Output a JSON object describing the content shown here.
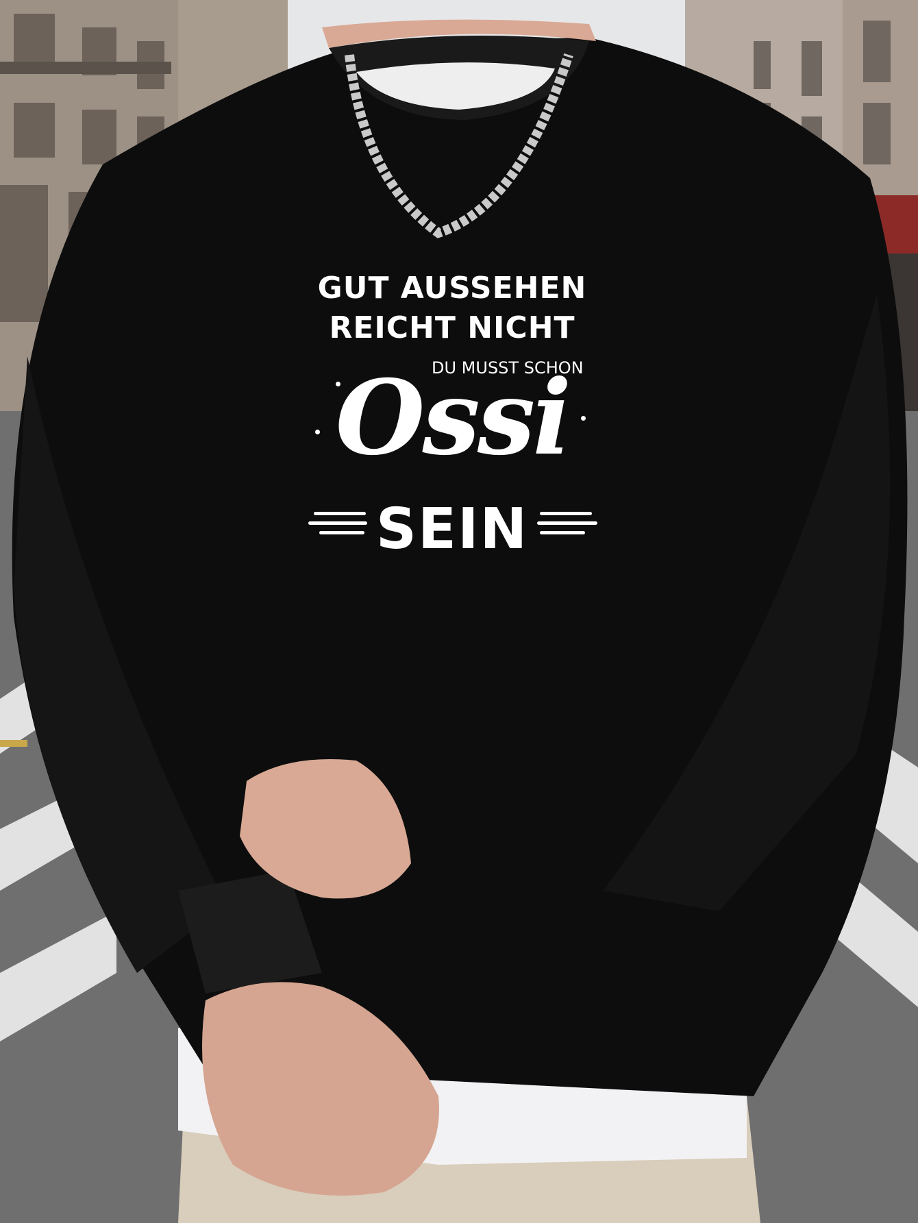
{
  "photo": {
    "subject": "person-in-black-sweatshirt",
    "colors": {
      "sweatshirt": "#0d0d0d",
      "sky": "#e6e7e9",
      "building_left": "#a89c8f",
      "building_right": "#b7aaa0",
      "road": "#6f6f70",
      "road_marking": "#e2e2e2",
      "skin": "#d9a995",
      "undershirt": "#f2f2f4",
      "pants": "#d9cdbb",
      "chain": "#c9c9c9",
      "shop_sign": "#8c2a27"
    }
  },
  "print": {
    "line1": "GUT AUSSEHEN",
    "line2": "REICHT NICHT",
    "line3": "DU MUSST SCHON",
    "line4": "Ossi",
    "line5": "SEIN"
  }
}
